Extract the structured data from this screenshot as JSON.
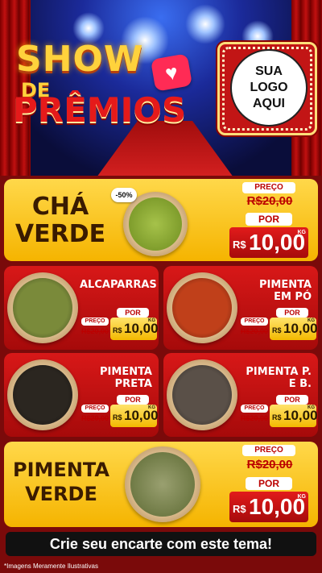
{
  "hero": {
    "title_line1": "SHOW",
    "title_line2": "DE",
    "title_line3": "PRÊMIOS",
    "logo_line1": "SUA",
    "logo_line2": "LOGO",
    "logo_line3": "AQUI",
    "heart_icon": "heart-icon"
  },
  "featured_top": {
    "name_line1": "CHÁ",
    "name_line2": "VERDE",
    "discount": "-50%",
    "preco_label": "PREÇO",
    "old_price": "R$20,00",
    "por_label": "POR",
    "new_currency": "R$",
    "new_price": "10,00",
    "unit": "KG"
  },
  "products": [
    {
      "name": "ALCAPARRAS",
      "preco_label": "PREÇO",
      "old_price": "R$20,00",
      "por_label": "POR",
      "currency": "R$",
      "price": "10,00",
      "unit": "KG",
      "color": "#7a8a3a"
    },
    {
      "name": "PIMENTA EM PÓ",
      "preco_label": "PREÇO",
      "old_price": "R$20,00",
      "por_label": "POR",
      "currency": "R$",
      "price": "10,00",
      "unit": "KG",
      "color": "#c0401a"
    },
    {
      "name": "PIMENTA PRETA",
      "preco_label": "PREÇO",
      "old_price": "R$20,00",
      "por_label": "POR",
      "currency": "R$",
      "price": "10,00",
      "unit": "KG",
      "color": "#2b2620"
    },
    {
      "name": "PIMENTA P. E B.",
      "preco_label": "PREÇO",
      "old_price": "R$20,00",
      "por_label": "POR",
      "currency": "R$",
      "price": "10,00",
      "unit": "KG",
      "color": "#5a5048"
    }
  ],
  "featured_bottom": {
    "name_line1": "PIMENTA",
    "name_line2": "VERDE",
    "preco_label": "PREÇO",
    "old_price": "R$20,00",
    "por_label": "POR",
    "new_currency": "R$",
    "new_price": "10,00",
    "unit": "KG"
  },
  "cta": "Crie seu encarte com este tema!",
  "disclaimer": "*Imagens Meramente Ilustrativas"
}
